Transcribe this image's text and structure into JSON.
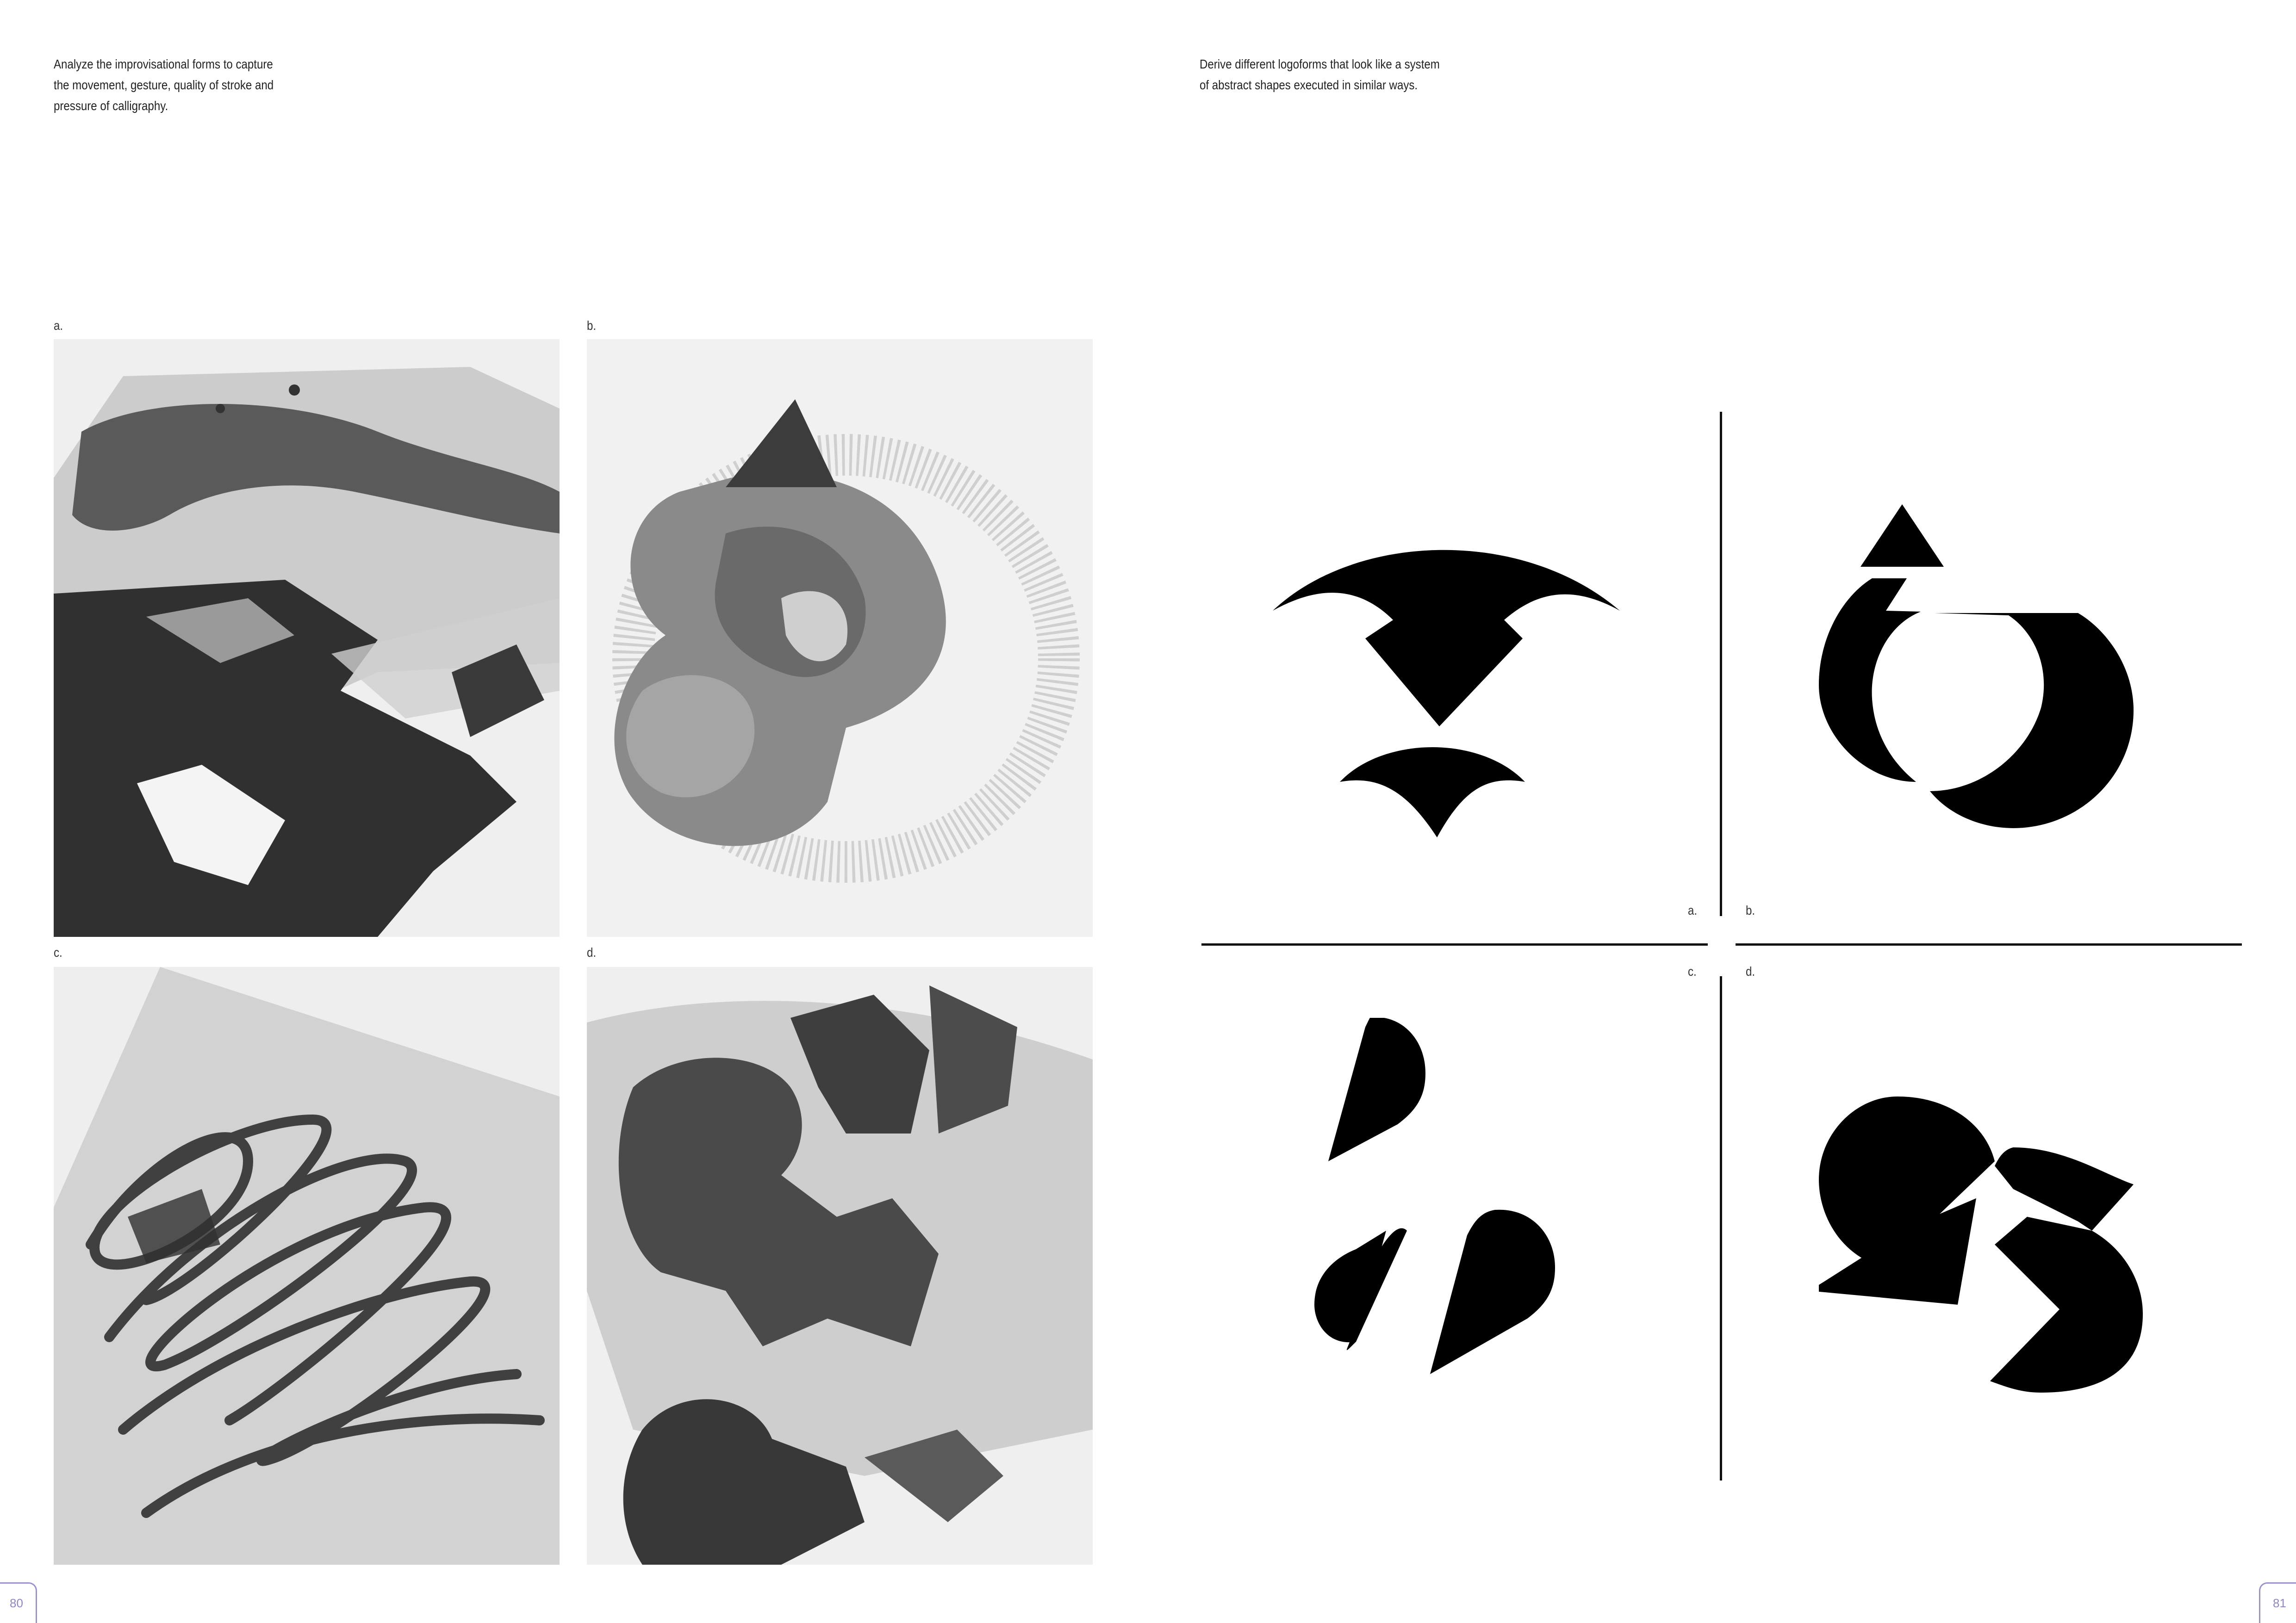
{
  "left_page": {
    "caption": "Analyze the improvisational forms to capture\nthe movement, gesture, quality of stroke and\npressure of calligraphy.",
    "labels": {
      "a": "a.",
      "b": "b.",
      "c": "c.",
      "d": "d."
    },
    "page_number": "80"
  },
  "right_page": {
    "caption": "Derive different logoforms that look like a system\nof abstract shapes executed in similar ways.",
    "labels": {
      "a": "a.",
      "b": "b.",
      "c": "c.",
      "d": "d."
    },
    "page_number": "81"
  },
  "colors": {
    "ink": "#111111",
    "page_number_accent": "#9a93cf"
  }
}
